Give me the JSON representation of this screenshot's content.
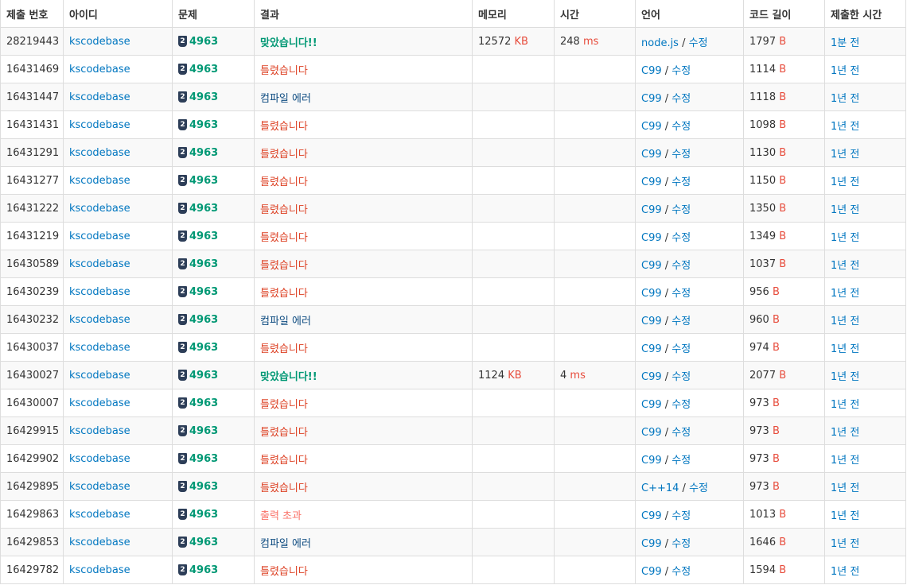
{
  "headers": [
    "제출 번호",
    "아이디",
    "문제",
    "결과",
    "메모리",
    "시간",
    "언어",
    "코드 길이",
    "제출한 시간"
  ],
  "units": {
    "kb": "KB",
    "ms": "ms",
    "bytes": "B"
  },
  "edit_label": "수정",
  "rows": [
    {
      "id": "28219443",
      "user": "kscodebase",
      "tier": "2",
      "problem": "4963",
      "result": "맞았습니다!!",
      "result_type": "ac",
      "memory": "12572",
      "time": "248",
      "lang": "node.js",
      "length": "1797",
      "when": "1분 전"
    },
    {
      "id": "16431469",
      "user": "kscodebase",
      "tier": "2",
      "problem": "4963",
      "result": "틀렸습니다",
      "result_type": "wa",
      "memory": "",
      "time": "",
      "lang": "C99",
      "length": "1114",
      "when": "1년 전"
    },
    {
      "id": "16431447",
      "user": "kscodebase",
      "tier": "2",
      "problem": "4963",
      "result": "컴파일 에러",
      "result_type": "ce",
      "memory": "",
      "time": "",
      "lang": "C99",
      "length": "1118",
      "when": "1년 전"
    },
    {
      "id": "16431431",
      "user": "kscodebase",
      "tier": "2",
      "problem": "4963",
      "result": "틀렸습니다",
      "result_type": "wa",
      "memory": "",
      "time": "",
      "lang": "C99",
      "length": "1098",
      "when": "1년 전"
    },
    {
      "id": "16431291",
      "user": "kscodebase",
      "tier": "2",
      "problem": "4963",
      "result": "틀렸습니다",
      "result_type": "wa",
      "memory": "",
      "time": "",
      "lang": "C99",
      "length": "1130",
      "when": "1년 전"
    },
    {
      "id": "16431277",
      "user": "kscodebase",
      "tier": "2",
      "problem": "4963",
      "result": "틀렸습니다",
      "result_type": "wa",
      "memory": "",
      "time": "",
      "lang": "C99",
      "length": "1150",
      "when": "1년 전"
    },
    {
      "id": "16431222",
      "user": "kscodebase",
      "tier": "2",
      "problem": "4963",
      "result": "틀렸습니다",
      "result_type": "wa",
      "memory": "",
      "time": "",
      "lang": "C99",
      "length": "1350",
      "when": "1년 전"
    },
    {
      "id": "16431219",
      "user": "kscodebase",
      "tier": "2",
      "problem": "4963",
      "result": "틀렸습니다",
      "result_type": "wa",
      "memory": "",
      "time": "",
      "lang": "C99",
      "length": "1349",
      "when": "1년 전"
    },
    {
      "id": "16430589",
      "user": "kscodebase",
      "tier": "2",
      "problem": "4963",
      "result": "틀렸습니다",
      "result_type": "wa",
      "memory": "",
      "time": "",
      "lang": "C99",
      "length": "1037",
      "when": "1년 전"
    },
    {
      "id": "16430239",
      "user": "kscodebase",
      "tier": "2",
      "problem": "4963",
      "result": "틀렸습니다",
      "result_type": "wa",
      "memory": "",
      "time": "",
      "lang": "C99",
      "length": "956",
      "when": "1년 전"
    },
    {
      "id": "16430232",
      "user": "kscodebase",
      "tier": "2",
      "problem": "4963",
      "result": "컴파일 에러",
      "result_type": "ce",
      "memory": "",
      "time": "",
      "lang": "C99",
      "length": "960",
      "when": "1년 전"
    },
    {
      "id": "16430037",
      "user": "kscodebase",
      "tier": "2",
      "problem": "4963",
      "result": "틀렸습니다",
      "result_type": "wa",
      "memory": "",
      "time": "",
      "lang": "C99",
      "length": "974",
      "when": "1년 전"
    },
    {
      "id": "16430027",
      "user": "kscodebase",
      "tier": "2",
      "problem": "4963",
      "result": "맞았습니다!!",
      "result_type": "ac",
      "memory": "1124",
      "time": "4",
      "lang": "C99",
      "length": "2077",
      "when": "1년 전"
    },
    {
      "id": "16430007",
      "user": "kscodebase",
      "tier": "2",
      "problem": "4963",
      "result": "틀렸습니다",
      "result_type": "wa",
      "memory": "",
      "time": "",
      "lang": "C99",
      "length": "973",
      "when": "1년 전"
    },
    {
      "id": "16429915",
      "user": "kscodebase",
      "tier": "2",
      "problem": "4963",
      "result": "틀렸습니다",
      "result_type": "wa",
      "memory": "",
      "time": "",
      "lang": "C99",
      "length": "973",
      "when": "1년 전"
    },
    {
      "id": "16429902",
      "user": "kscodebase",
      "tier": "2",
      "problem": "4963",
      "result": "틀렸습니다",
      "result_type": "wa",
      "memory": "",
      "time": "",
      "lang": "C99",
      "length": "973",
      "when": "1년 전"
    },
    {
      "id": "16429895",
      "user": "kscodebase",
      "tier": "2",
      "problem": "4963",
      "result": "틀렸습니다",
      "result_type": "wa",
      "memory": "",
      "time": "",
      "lang": "C++14",
      "length": "973",
      "when": "1년 전"
    },
    {
      "id": "16429863",
      "user": "kscodebase",
      "tier": "2",
      "problem": "4963",
      "result": "출력 초과",
      "result_type": "ole",
      "memory": "",
      "time": "",
      "lang": "C99",
      "length": "1013",
      "when": "1년 전"
    },
    {
      "id": "16429853",
      "user": "kscodebase",
      "tier": "2",
      "problem": "4963",
      "result": "컴파일 에러",
      "result_type": "ce",
      "memory": "",
      "time": "",
      "lang": "C99",
      "length": "1646",
      "when": "1년 전"
    },
    {
      "id": "16429782",
      "user": "kscodebase",
      "tier": "2",
      "problem": "4963",
      "result": "틀렸습니다",
      "result_type": "wa",
      "memory": "",
      "time": "",
      "lang": "C99",
      "length": "1594",
      "when": "1년 전"
    }
  ],
  "colors": {
    "link": "#0076c0",
    "problem": "#009874",
    "accepted": "#009874",
    "wrong": "#dd4124",
    "compile_error": "#0f4c81",
    "output_limit": "#fa7268",
    "unit": "#e74c3c"
  }
}
